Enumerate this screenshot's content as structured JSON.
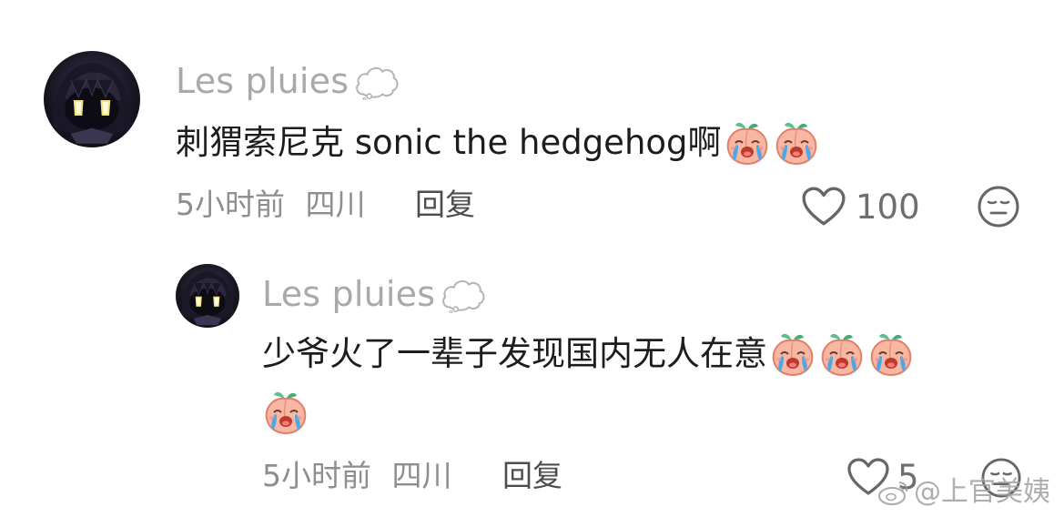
{
  "comment": {
    "username": "Les pluies",
    "username_badge_icon": "cloud-icon",
    "text": "刺猬索尼克 sonic the hedgehog啊",
    "emojis": [
      "crying-peach-emoji",
      "crying-peach-emoji"
    ],
    "time": "5小时前",
    "location": "四川",
    "reply_label": "回复",
    "like_count": "100"
  },
  "reply": {
    "username": "Les pluies",
    "username_badge_icon": "cloud-icon",
    "text": "少爷火了一辈子发现国内无人在意",
    "emojis_line1": [
      "crying-peach-emoji",
      "crying-peach-emoji",
      "crying-peach-emoji"
    ],
    "emojis_line2": [
      "crying-peach-emoji"
    ],
    "time": "5小时前",
    "location": "四川",
    "reply_label": "回复",
    "like_count": "5"
  },
  "watermark": {
    "text": "@上官美姨"
  },
  "colors": {
    "username": "#a9a9a9",
    "text": "#1d1d1d",
    "meta": "#8e8e8e",
    "reply": "#4d4d4d"
  }
}
